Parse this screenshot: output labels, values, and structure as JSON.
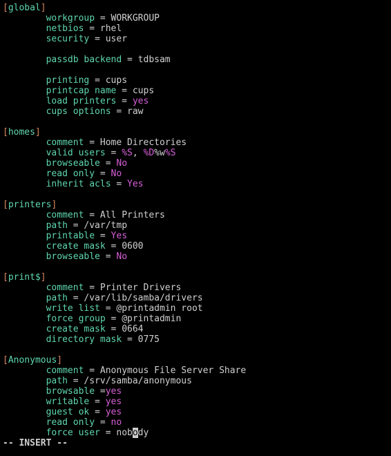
{
  "mode_line": "-- INSERT --",
  "sections": [
    {
      "name": "global",
      "entries": [
        {
          "key": "workgroup",
          "sep": " = ",
          "value": "WORKGROUP",
          "vstyle": "white"
        },
        {
          "key": "netbios",
          "sep": " = ",
          "value": "rhel",
          "vstyle": "white"
        },
        {
          "key": "security",
          "sep": " = ",
          "value": "user",
          "vstyle": "white"
        },
        {
          "blank": true
        },
        {
          "key": "passdb backend",
          "sep": " = ",
          "value": "tdbsam",
          "vstyle": "white"
        },
        {
          "blank": true
        },
        {
          "key": "printing",
          "sep": " = ",
          "value": "cups",
          "vstyle": "white"
        },
        {
          "key": "printcap name",
          "sep": " = ",
          "value": "cups",
          "vstyle": "white"
        },
        {
          "key": "load printers",
          "sep": " = ",
          "value": "yes",
          "vstyle": "magenta"
        },
        {
          "key": "cups options",
          "sep": " = ",
          "value": "raw",
          "vstyle": "white"
        }
      ]
    },
    {
      "name": "homes",
      "entries": [
        {
          "key": "comment",
          "sep": " = ",
          "value": "Home Directories",
          "vstyle": "white"
        },
        {
          "key": "valid users",
          "sep": " = ",
          "segments": [
            {
              "t": "%S",
              "s": "magenta"
            },
            {
              "t": ", ",
              "s": "white"
            },
            {
              "t": "%D",
              "s": "magenta"
            },
            {
              "t": "%w",
              "s": "white"
            },
            {
              "t": "%S",
              "s": "magenta"
            }
          ]
        },
        {
          "key": "browseable",
          "sep": " = ",
          "value": "No",
          "vstyle": "magenta"
        },
        {
          "key": "read only",
          "sep": " = ",
          "value": "No",
          "vstyle": "magenta"
        },
        {
          "key": "inherit acls",
          "sep": " = ",
          "value": "Yes",
          "vstyle": "magenta"
        }
      ]
    },
    {
      "name": "printers",
      "entries": [
        {
          "key": "comment",
          "sep": " = ",
          "value": "All Printers",
          "vstyle": "white"
        },
        {
          "key": "path",
          "sep": " = ",
          "value": "/var/tmp",
          "vstyle": "white"
        },
        {
          "key": "printable",
          "sep": " = ",
          "value": "Yes",
          "vstyle": "magenta"
        },
        {
          "key": "create mask",
          "sep": " = ",
          "value": "0600",
          "vstyle": "white"
        },
        {
          "key": "browseable",
          "sep": " = ",
          "value": "No",
          "vstyle": "magenta"
        }
      ]
    },
    {
      "name": "print$",
      "entries": [
        {
          "key": "comment",
          "sep": " = ",
          "value": "Printer Drivers",
          "vstyle": "white"
        },
        {
          "key": "path",
          "sep": " = ",
          "value": "/var/lib/samba/drivers",
          "vstyle": "white"
        },
        {
          "key": "write list",
          "sep": " = ",
          "value": "@printadmin root",
          "vstyle": "white"
        },
        {
          "key": "force group",
          "sep": " = ",
          "value": "@printadmin",
          "vstyle": "white"
        },
        {
          "key": "create mask",
          "sep": " = ",
          "value": "0664",
          "vstyle": "white"
        },
        {
          "key": "directory mask",
          "sep": " = ",
          "value": "0775",
          "vstyle": "white"
        }
      ]
    },
    {
      "name": "Anonymous",
      "entries": [
        {
          "key": "comment",
          "sep": " = ",
          "value": "Anonymous File Server Share",
          "vstyle": "white"
        },
        {
          "key": "path",
          "sep": " = ",
          "value": "/srv/samba/anonymous",
          "vstyle": "white"
        },
        {
          "key": "browsable",
          "sep": " =",
          "value": "yes",
          "vstyle": "magenta"
        },
        {
          "key": "writable",
          "sep": " = ",
          "value": "yes",
          "vstyle": "magenta"
        },
        {
          "key": "guest ok",
          "sep": " = ",
          "value": "yes",
          "vstyle": "magenta"
        },
        {
          "key": "read only",
          "sep": " = ",
          "value": "no",
          "vstyle": "magenta"
        },
        {
          "key": "force user",
          "sep": " = ",
          "segments": [
            {
              "t": "nob",
              "s": "white"
            },
            {
              "t": "o",
              "s": "cursor"
            },
            {
              "t": "dy",
              "s": "white"
            }
          ]
        }
      ]
    }
  ]
}
